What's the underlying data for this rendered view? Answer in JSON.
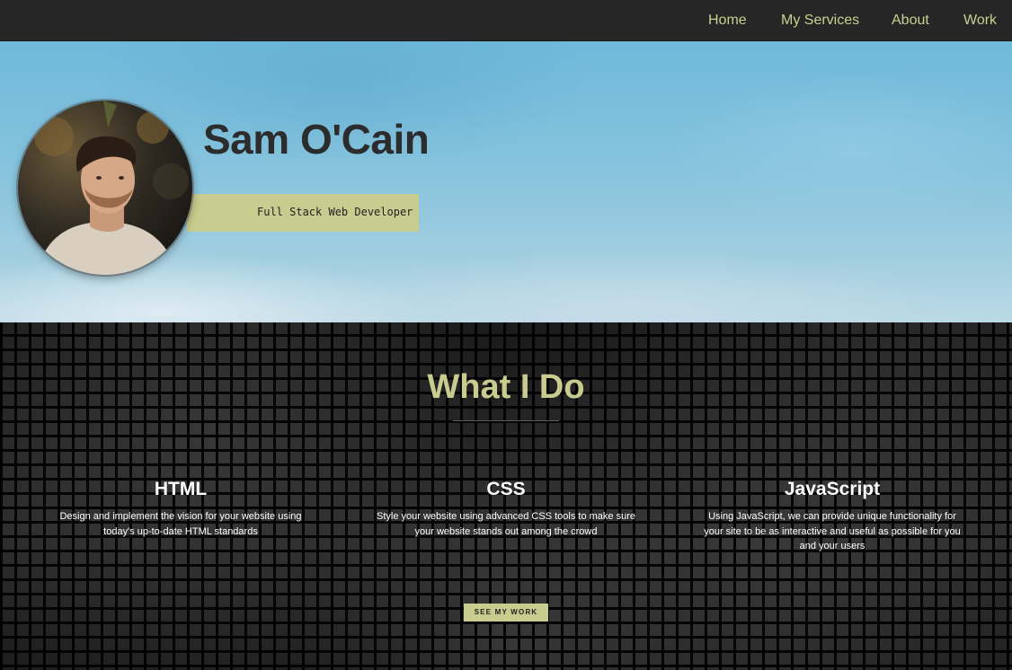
{
  "nav": {
    "items": [
      {
        "label": "Home"
      },
      {
        "label": "My Services"
      },
      {
        "label": "About"
      },
      {
        "label": "Work"
      }
    ]
  },
  "hero": {
    "name": "Sam O'Cain",
    "tagline": "Full Stack Web Developer",
    "avatar_icon": "profile-photo"
  },
  "services": {
    "title": "What I Do",
    "items": [
      {
        "title": "HTML",
        "lines": [
          "Design and implement the vision for your website using",
          "today's up-to-date HTML standards"
        ]
      },
      {
        "title": "CSS",
        "lines": [
          "Style your website using advanced CSS tools to make sure",
          "your website stands out among the crowd"
        ]
      },
      {
        "title": "JavaScript",
        "lines": [
          "Using JavaScript, we can provide unique functionality for",
          "your site to be as interactive and useful as possible for you",
          "and your users"
        ]
      }
    ],
    "button_label": "SEE MY WORK"
  },
  "colors": {
    "accent": "#c9cc8f",
    "nav_bg": "#262626",
    "hero_sky": "#86c3dd",
    "name_text": "#2c2c2c"
  }
}
